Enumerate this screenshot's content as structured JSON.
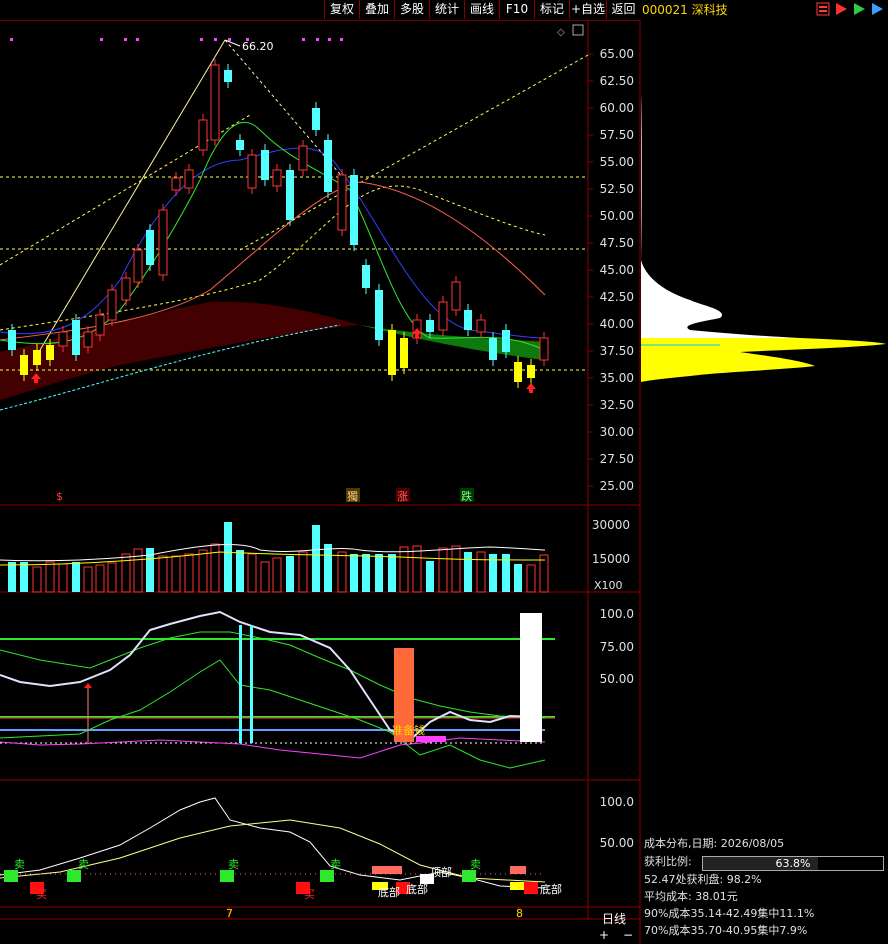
{
  "toolbar": {
    "buttons": [
      "复权",
      "叠加",
      "多股",
      "统计",
      "画线",
      "F10",
      "标记",
      "+自选",
      "返回"
    ]
  },
  "symbol": {
    "code": "000021",
    "name": "深科技"
  },
  "main_chart": {
    "max_label": "66.20",
    "price_axis": [
      "65.00",
      "62.50",
      "60.00",
      "57.50",
      "55.00",
      "52.50",
      "50.00",
      "47.50",
      "45.00",
      "42.50",
      "40.00",
      "37.50",
      "35.00",
      "32.50",
      "30.00",
      "27.50",
      "25.00"
    ],
    "signals": [
      "$",
      "獨",
      "涨",
      "跌"
    ]
  },
  "volume_panel": {
    "axis": [
      "30000",
      "15000"
    ],
    "unit": "X100"
  },
  "indicator1": {
    "axis": [
      "100.0",
      "75.00",
      "50.00"
    ],
    "label": "准备钱"
  },
  "indicator2": {
    "axis": [
      "100.0",
      "50.00"
    ],
    "labels": [
      "卖",
      "卖",
      "卖",
      "卖",
      "卖",
      "卖",
      "买",
      "买",
      "顶部",
      "底部",
      "底部",
      "底部"
    ]
  },
  "date_axis": [
    "7",
    "8"
  ],
  "cost_panel": {
    "title": "成本分布,日期: 2026/08/05",
    "profit_label": "获利比例:",
    "profit_ratio_text": "63.8%",
    "profit_ratio": 0.638,
    "line1": "52.47处获利盘: 98.2%",
    "line2": "平均成本: 38.01元",
    "line3": "90%成本35.14-42.49集中11.1%",
    "line4": "70%成本35.70-40.95集中7.9%"
  },
  "period": "日线",
  "zoom": {
    "in": "+",
    "out": "−"
  },
  "colors": {
    "up": "#ff3333",
    "down": "#54ffff",
    "ma_white": "#ffffff",
    "ma_yellow": "#ffff00",
    "grid": "#8b0000",
    "axis_text": "#e0e0e0"
  }
}
